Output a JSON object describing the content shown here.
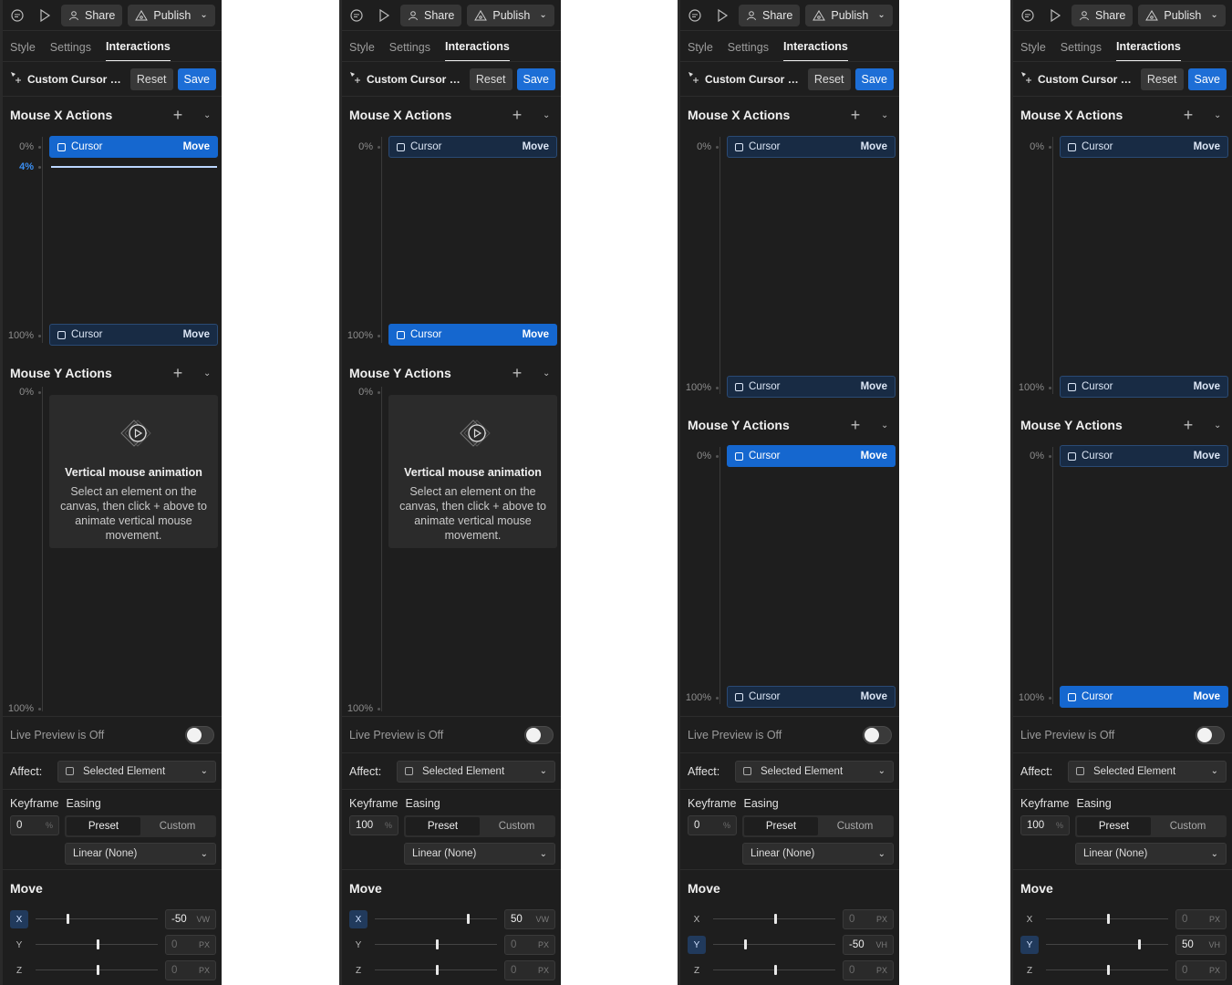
{
  "topbar": {
    "share": "Share",
    "publish": "Publish"
  },
  "tabs": [
    "Style",
    "Settings",
    "Interactions"
  ],
  "header": {
    "title": "Custom Cursor M...",
    "reset": "Reset",
    "save": "Save"
  },
  "labels": {
    "mouse_x": "Mouse X Actions",
    "mouse_y": "Mouse Y Actions",
    "pct_0": "0%",
    "pct_100": "100%",
    "pct_4": "4%",
    "key_name": "Cursor",
    "key_action": "Move",
    "empty_title": "Vertical mouse animation",
    "empty_desc": "Select an element on the canvas, then click + above to animate vertical mouse movement.",
    "live": "Live Preview is Off",
    "affect": "Affect:",
    "affect_value": "Selected Element",
    "keyframe": "Keyframe",
    "easing": "Easing",
    "preset": "Preset",
    "custom": "Custom",
    "easing_value": "Linear (None)",
    "move": "Move",
    "pct_unit": "%",
    "axis_x": "X",
    "axis_y": "Y",
    "axis_z": "Z"
  },
  "panels": [
    {
      "keyframe": "0",
      "move": [
        {
          "value": "-50",
          "unit": "VW",
          "dim": false,
          "pos": 0.25
        },
        {
          "value": "0",
          "unit": "PX",
          "dim": true,
          "pos": 0.5
        },
        {
          "value": "0",
          "unit": "PX",
          "dim": true,
          "pos": 0.5
        }
      ]
    },
    {
      "keyframe": "100",
      "move": [
        {
          "value": "50",
          "unit": "VW",
          "dim": false,
          "pos": 0.75
        },
        {
          "value": "0",
          "unit": "PX",
          "dim": true,
          "pos": 0.5
        },
        {
          "value": "0",
          "unit": "PX",
          "dim": true,
          "pos": 0.5
        }
      ]
    },
    {
      "keyframe": "0",
      "move": [
        {
          "value": "0",
          "unit": "PX",
          "dim": true,
          "pos": 0.5
        },
        {
          "value": "-50",
          "unit": "VH",
          "dim": false,
          "pos": 0.25
        },
        {
          "value": "0",
          "unit": "PX",
          "dim": true,
          "pos": 0.5
        }
      ]
    },
    {
      "keyframe": "100",
      "move": [
        {
          "value": "0",
          "unit": "PX",
          "dim": true,
          "pos": 0.5
        },
        {
          "value": "50",
          "unit": "VH",
          "dim": false,
          "pos": 0.75
        },
        {
          "value": "0",
          "unit": "PX",
          "dim": true,
          "pos": 0.5
        }
      ]
    }
  ]
}
